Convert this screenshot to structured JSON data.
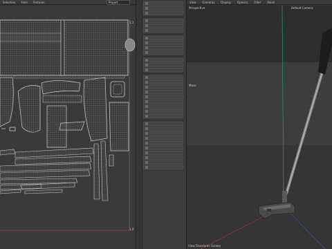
{
  "uv_editor": {
    "menu": [
      "Selection",
      "Field",
      "Textures"
    ],
    "mode_value": "Project",
    "corner_labels": {
      "top_right": "1,1",
      "bottom_right": "1,0"
    }
  },
  "viewport": {
    "menu": [
      "View",
      "Cameras",
      "Display",
      "Options",
      "Filter",
      "Panel"
    ],
    "view_name": "Perspective",
    "camera_name": "Default Camera",
    "move_label": "Move",
    "footer": "View Transform: Screen"
  },
  "colors": {
    "uv_wire": "#bfbfbf",
    "uv_bg": "#3a3a3a",
    "axis_green": "#2fae7a",
    "axis_red": "#b03a3a",
    "axis_blue": "#3a4fb0",
    "grid_band": "#3d3d3d",
    "shaft": "#8a8a8a",
    "grip": "#1c1c1c"
  }
}
